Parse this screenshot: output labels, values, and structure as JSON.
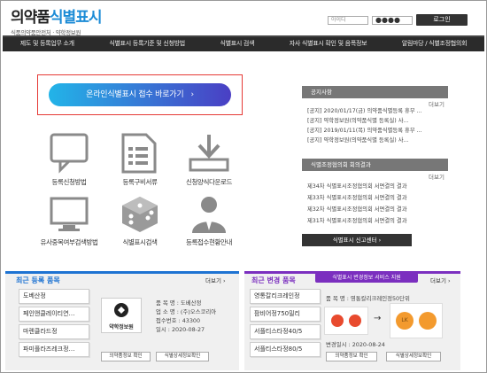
{
  "header": {
    "logo_main": "의약품",
    "logo_accent": "식별표시",
    "logo_sub": "식품의약품안전처 · 약학정보원",
    "login_id_placeholder": "아이디",
    "login_pw_value": "●●●●",
    "login_button": "로그인"
  },
  "nav": {
    "items": [
      "제도 및 등록업무 소개",
      "식별표시 등록기준 및 신청방법",
      "식별표시 검색",
      "자사 식별표시 확인 및 음폭정보",
      "알림마당 / 식별조정협의회"
    ]
  },
  "cta": {
    "label": "온라인식별표시 접수 바로가기",
    "chevron": "›"
  },
  "icons": [
    {
      "name": "speech-bubble-icon",
      "label": "등록신청방법"
    },
    {
      "name": "document-form-icon",
      "label": "등록구비서류"
    },
    {
      "name": "download-icon",
      "label": "신청양식다운로드"
    },
    {
      "name": "monitor-icon",
      "label": "유사중복여부검색방법"
    },
    {
      "name": "dice-icon",
      "label": "식별표시검색"
    },
    {
      "name": "user-guide-icon",
      "label": "등록접수현황안내"
    }
  ],
  "notice": {
    "title": "공지사항",
    "more": "더보기",
    "items": [
      "[공지] 2020/01/17(금) 의약품식별등록 휴무 ...",
      "[공지] 약학정보원(의약품식별 등록실) 사...",
      "[공지] 2019/01/11(목) 의약품식별등록 휴무 ...",
      "[공지] 약학정보원(의약품식별 등록실) 사..."
    ]
  },
  "council": {
    "title": "식별조정협의회 회의결과",
    "more": "더보기",
    "items": [
      "제34차 식별표시조정협의회 서면결의 결과",
      "제33차 식별표시조정협의회 서면결의 결과",
      "제32차 식별표시조정협의회 서면결의 결과",
      "제31차 식별표시조정협의회 서면결의 결과"
    ]
  },
  "report_button": "식별표시 신고센터  ›",
  "recent_reg": {
    "title": "최근 등록 품목",
    "more": "더보기 ›",
    "accent": "#1e73d2",
    "items": [
      "도베산정",
      "페인앤클레이티연…",
      "마렌클라드정",
      "파미플라즈레크정…"
    ],
    "details": [
      "품 목 명 : 도베산정",
      "업 소 명 : (주)오스코리아",
      "접수번호 : 43300",
      "일시 : 2020-08-27"
    ],
    "seal_text": "약학정보원",
    "btn1": "의약품정보 확인",
    "btn2": "식별상세정보확인"
  },
  "recent_change": {
    "title": "최근 변경 품목",
    "badge": "식별표시 변경정보 서비스 지원",
    "more": "더보기 ›",
    "accent": "#7b2fbf",
    "items": [
      "영통칼리크레인정",
      "팜비어정750밀리",
      "서플티스타정40/5",
      "서플티스타정80/5"
    ],
    "name_line": "품 목 명 : 영통칼리크레인정50단위",
    "date_line": "변경일시 : 2020-08-24",
    "pill_text": "LK",
    "arrow": "→",
    "btn1": "의약품정보 확인",
    "btn2": "식별상세정보확인"
  }
}
